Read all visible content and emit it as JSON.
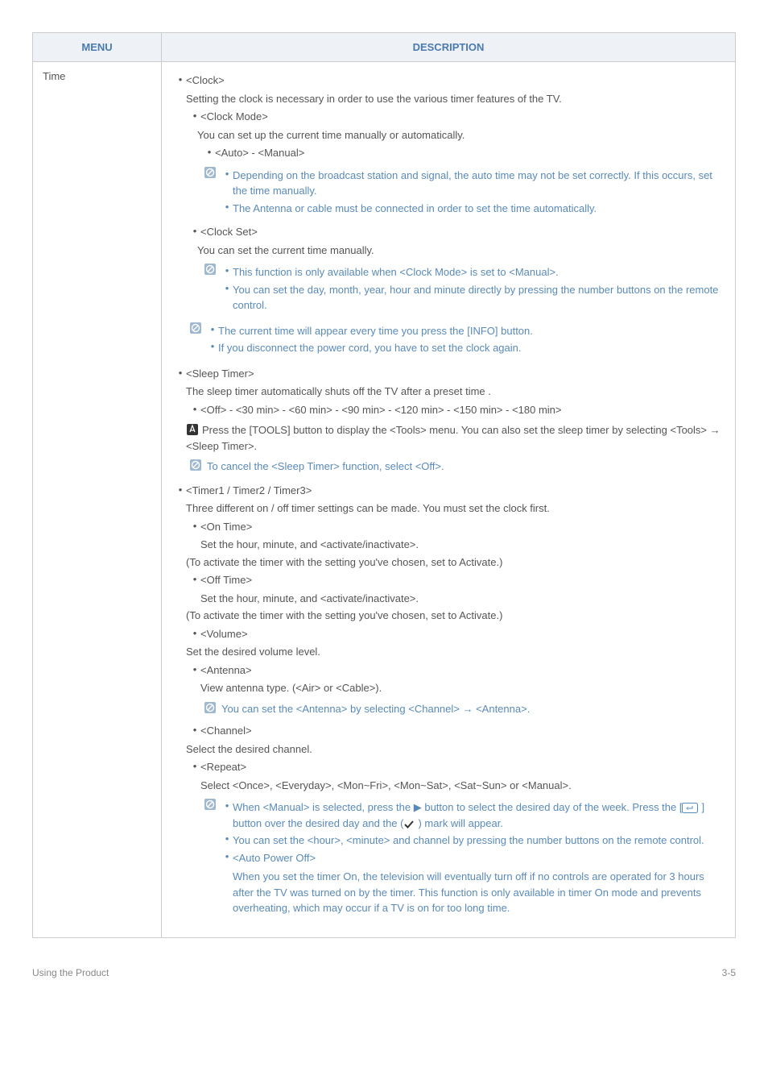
{
  "header": {
    "menu": "MENU",
    "description": "DESCRIPTION"
  },
  "row": {
    "menu": "Time",
    "clock": {
      "title": "<Clock>",
      "intro": "Setting the clock is necessary in order to use the various timer features of the TV.",
      "clockMode": {
        "label": "<Clock Mode>",
        "desc": "You can set up the current time manually or automatically.",
        "options": "<Auto> - <Manual>",
        "note1": "Depending on the broadcast station and signal, the auto time may not be set correctly. If this occurs, set the time manually.",
        "note2": "The Antenna or cable must be connected in order to set the time automatically."
      },
      "clockSet": {
        "label": "<Clock Set>",
        "desc": "You can set the current time manually.",
        "note1": "This function is only available when <Clock Mode> is set to <Manual>.",
        "note2": "You can set the day, month, year, hour and minute directly by pressing the number buttons on the remote control."
      },
      "globalNote1": "The current time will appear every time you press the [INFO] button.",
      "globalNote2": "If you disconnect the power cord, you have to set the clock again."
    },
    "sleep": {
      "title": "<Sleep Timer>",
      "intro": "The sleep timer automatically shuts off the TV after a preset time .",
      "options": "<Off> - <30 min> - <60 min> - <90 min> - <120 min> - <150 min> - <180 min>",
      "tools": "Press the [TOOLS] button to display the <Tools> menu. You can also set the sleep timer by selecting <Tools> → <Sleep Timer>.",
      "cancel": "To cancel the <Sleep Timer> function, select <Off>."
    },
    "timer": {
      "title": "<Timer1 / Timer2 / Timer3>",
      "intro": "Three different on / off timer settings can be made. You must set the clock first.",
      "onTime": {
        "label": "<On Time>",
        "desc": "Set the hour, minute, and <activate/inactivate>.",
        "activate": "(To activate the timer with the setting you've chosen, set to Activate.)"
      },
      "offTime": {
        "label": "<Off Time>",
        "desc": "Set the hour, minute, and <activate/inactivate>.",
        "activate": "(To activate the timer with the setting you've chosen, set to Activate.)"
      },
      "volume": {
        "label": "<Volume>",
        "desc": "Set the desired volume level."
      },
      "antenna": {
        "label": "<Antenna>",
        "desc": "View antenna type. (<Air> or <Cable>).",
        "note": "You can set the <Antenna> by selecting <Channel> → <Antenna>."
      },
      "channel": {
        "label": "<Channel>",
        "desc": "Select the desired channel."
      },
      "repeat": {
        "label": "<Repeat>",
        "desc": "Select <Once>, <Everyday>, <Mon~Fri>, <Mon~Sat>, <Sat~Sun> or <Manual>."
      },
      "finalNotes": {
        "n1a": "When <Manual> is selected, press the ▶ button to select the desired day of the week. Press the [",
        "n1b": "] button over the desired day and the (",
        "n1c": ") mark will appear.",
        "n2": "You can set the <hour>, <minute> and channel by pressing the number buttons on the remote control.",
        "apo": "<Auto Power Off>",
        "apoDesc": "When you set the timer On, the television will eventually turn off if no controls are operated for 3 hours after the TV was turned on by the timer. This function is only available in timer On mode and prevents overheating, which may occur if a TV is on for too long time."
      }
    }
  },
  "footer": {
    "left": "Using the Product",
    "right": "3-5"
  }
}
